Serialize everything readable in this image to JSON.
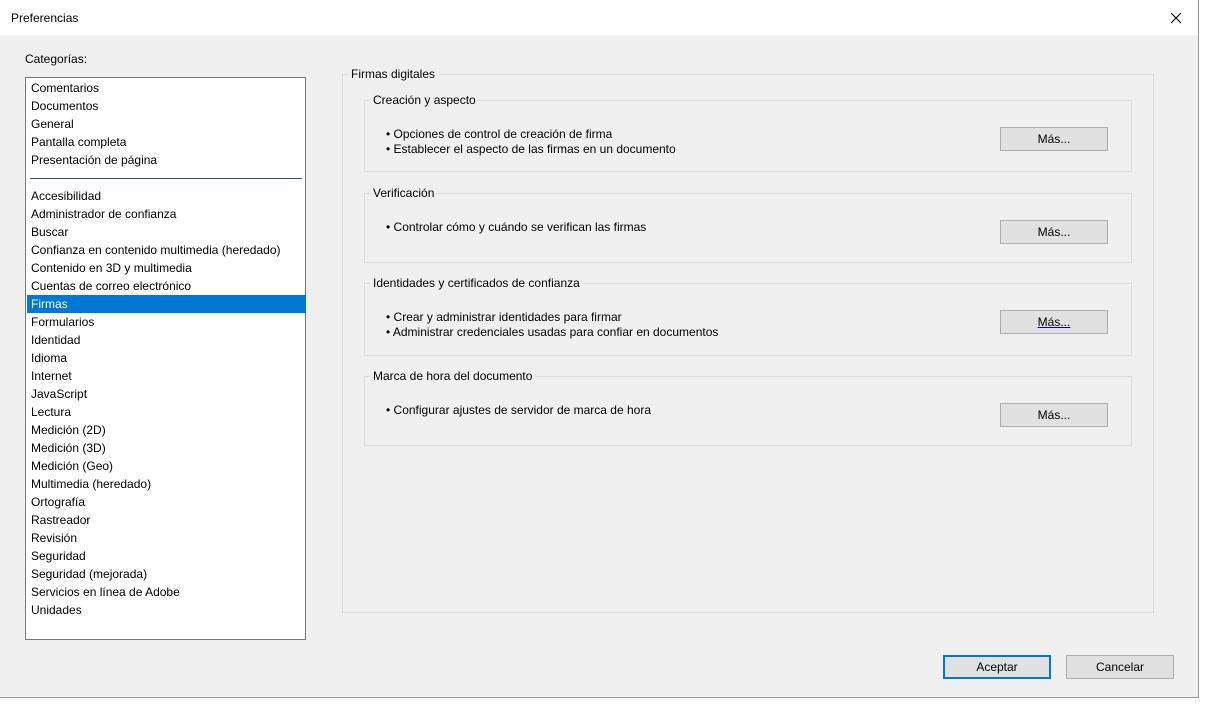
{
  "window": {
    "title": "Preferencias"
  },
  "categories": {
    "label": "Categorías:",
    "group1": [
      "Comentarios",
      "Documentos",
      "General",
      "Pantalla completa",
      "Presentación de página"
    ],
    "group2": [
      "Accesibilidad",
      "Administrador de confianza",
      "Buscar",
      "Confianza en contenido multimedia (heredado)",
      "Contenido en 3D y multimedia",
      "Cuentas de correo electrónico",
      "Firmas",
      "Formularios",
      "Identidad",
      "Idioma",
      "Internet",
      "JavaScript",
      "Lectura",
      "Medición (2D)",
      "Medición (3D)",
      "Medición (Geo)",
      "Multimedia (heredado)",
      "Ortografía",
      "Rastreador",
      "Revisión",
      "Seguridad",
      "Seguridad (mejorada)",
      "Servicios en línea de Adobe",
      "Unidades"
    ],
    "selected": "Firmas"
  },
  "main": {
    "group_title": "Firmas digitales",
    "sections": [
      {
        "title": "Creación y aspecto",
        "bullets": [
          "• Opciones de control de creación de firma",
          "• Establecer el aspecto de las firmas en un documento"
        ],
        "button": "Más..."
      },
      {
        "title": "Verificación",
        "bullets": [
          "• Controlar cómo y cuándo se verifican las firmas"
        ],
        "button": "Más..."
      },
      {
        "title": "Identidades y certificados de confianza",
        "bullets": [
          "• Crear y administrar identidades para firmar",
          "• Administrar credenciales usadas para confiar en documentos"
        ],
        "button": "Más..."
      },
      {
        "title": "Marca de hora del documento",
        "bullets": [
          "• Configurar ajustes de servidor de marca de hora"
        ],
        "button": "Más..."
      }
    ]
  },
  "footer": {
    "ok": "Aceptar",
    "cancel": "Cancelar"
  },
  "colors": {
    "selection": "#0078d7",
    "dialog_bg": "#f0f0f0"
  }
}
